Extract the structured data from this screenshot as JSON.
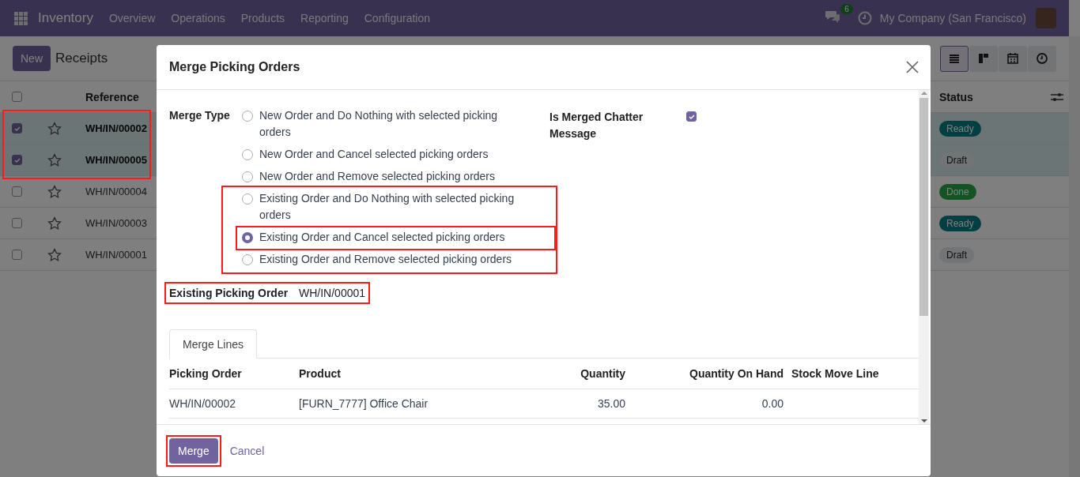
{
  "navbar": {
    "app": "Inventory",
    "menu": [
      "Overview",
      "Operations",
      "Products",
      "Reporting",
      "Configuration"
    ],
    "chat_count": "6",
    "company": "My Company (San Francisco)"
  },
  "control_panel": {
    "new_button": "New",
    "title": "Receipts",
    "views": [
      {
        "kind": "list",
        "selected": true
      },
      {
        "kind": "kanban",
        "selected": false
      },
      {
        "kind": "calendar",
        "selected": false
      },
      {
        "kind": "activity",
        "selected": false
      }
    ]
  },
  "list": {
    "columns": [
      "Reference",
      "Status"
    ],
    "all_selected": false,
    "rows": [
      {
        "reference": "WH/IN/00002",
        "selected": true,
        "highlighted": true,
        "status": {
          "label": "Ready",
          "kind": "ready"
        }
      },
      {
        "reference": "WH/IN/00005",
        "selected": true,
        "highlighted": true,
        "status": {
          "label": "Draft",
          "kind": "draft"
        }
      },
      {
        "reference": "WH/IN/00004",
        "selected": false,
        "highlighted": false,
        "status": {
          "label": "Done",
          "kind": "done"
        }
      },
      {
        "reference": "WH/IN/00003",
        "selected": false,
        "highlighted": false,
        "status": {
          "label": "Ready",
          "kind": "ready"
        }
      },
      {
        "reference": "WH/IN/00001",
        "selected": false,
        "highlighted": false,
        "status": {
          "label": "Draft",
          "kind": "draft"
        }
      }
    ]
  },
  "dialog": {
    "title": "Merge Picking Orders",
    "merge_type": {
      "label": "Merge Type",
      "options": [
        {
          "label": "New Order and Do Nothing with selected picking orders",
          "selected": false,
          "highlighted": false,
          "group_highlighted": false
        },
        {
          "label": "New Order and Cancel selected picking orders",
          "selected": false,
          "highlighted": false,
          "group_highlighted": false
        },
        {
          "label": "New Order and Remove selected picking orders",
          "selected": false,
          "highlighted": false,
          "group_highlighted": false
        },
        {
          "label": "Existing Order and Do Nothing with selected picking orders",
          "selected": false,
          "highlighted": false,
          "group_highlighted": true
        },
        {
          "label": "Existing Order and Cancel selected picking orders",
          "selected": true,
          "highlighted": true,
          "group_highlighted": true
        },
        {
          "label": "Existing Order and Remove selected picking orders",
          "selected": false,
          "highlighted": false,
          "group_highlighted": true
        }
      ]
    },
    "chatter": {
      "label": "Is Merged Chatter Message",
      "checked": true
    },
    "existing_picking_order": {
      "label": "Existing Picking Order",
      "value": "WH/IN/00001",
      "highlighted": true
    },
    "tabs": [
      {
        "label": "Merge Lines",
        "selected": true
      }
    ],
    "lines": {
      "columns": [
        {
          "label": "Picking Order",
          "kind": "text"
        },
        {
          "label": "Product",
          "kind": "text"
        },
        {
          "label": "Quantity",
          "kind": "number"
        },
        {
          "label": "Quantity On Hand",
          "kind": "number"
        },
        {
          "label": "Stock Move Line",
          "kind": "text"
        }
      ],
      "rows": [
        {
          "cells": [
            "WH/IN/00002",
            "[FURN_7777] Office Chair",
            "35.00",
            "0.00"
          ]
        }
      ]
    },
    "buttons": [
      {
        "label": "Merge",
        "kind": "primary",
        "highlighted": true
      },
      {
        "label": "Cancel",
        "kind": "link",
        "highlighted": false
      }
    ]
  }
}
